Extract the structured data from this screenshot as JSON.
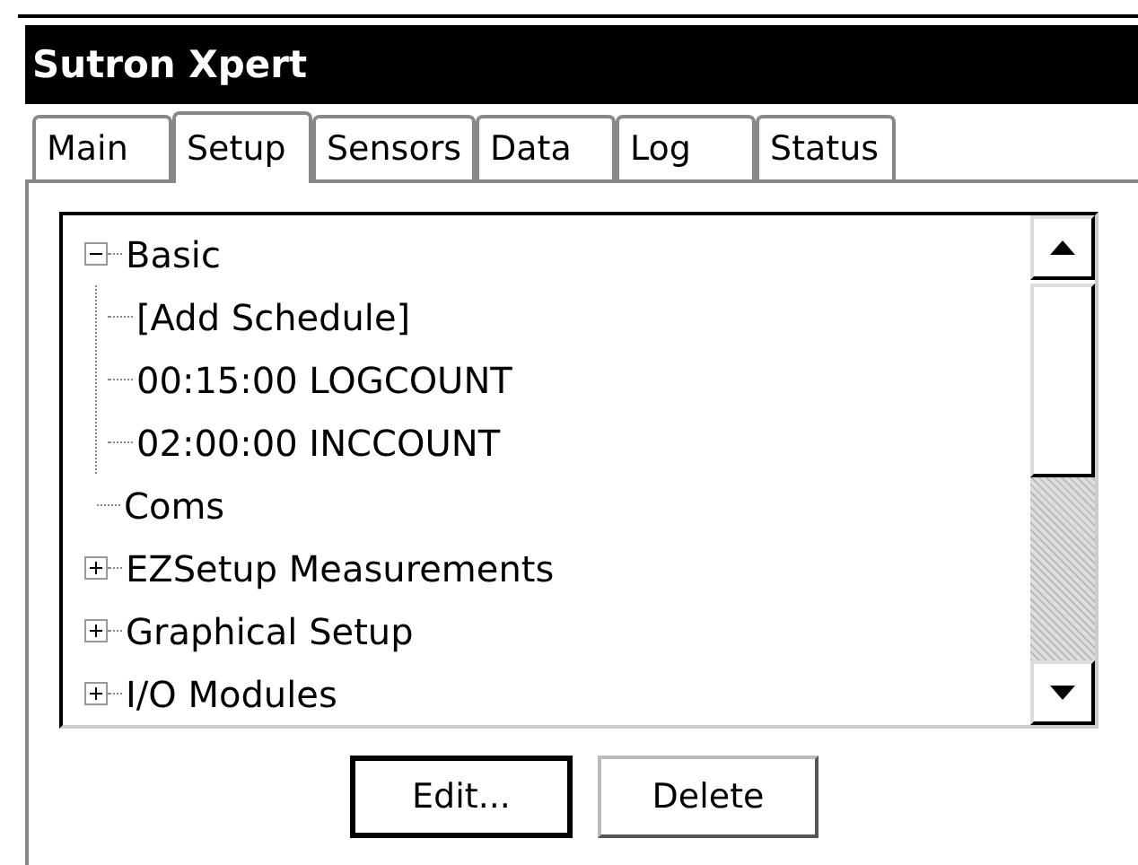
{
  "window": {
    "title": "Sutron Xpert"
  },
  "tabs": [
    {
      "label": "Main",
      "selected": false
    },
    {
      "label": "Setup",
      "selected": true
    },
    {
      "label": "Sensors",
      "selected": false
    },
    {
      "label": "Data",
      "selected": false
    },
    {
      "label": "Log",
      "selected": false
    },
    {
      "label": "Status",
      "selected": false
    }
  ],
  "tree": [
    {
      "label": "Basic",
      "expanded": true,
      "children": [
        {
          "label": "[Add Schedule]"
        },
        {
          "label": "00:15:00 LOGCOUNT"
        },
        {
          "label": "02:00:00 INCCOUNT"
        }
      ]
    },
    {
      "label": "Coms"
    },
    {
      "label": "EZSetup Measurements",
      "expanded": false
    },
    {
      "label": "Graphical Setup",
      "expanded": false
    },
    {
      "label": "I/O Modules",
      "expanded": false
    }
  ],
  "buttons": [
    {
      "label": "Edit...",
      "kind": "default"
    },
    {
      "label": "Delete",
      "kind": "normal"
    }
  ]
}
